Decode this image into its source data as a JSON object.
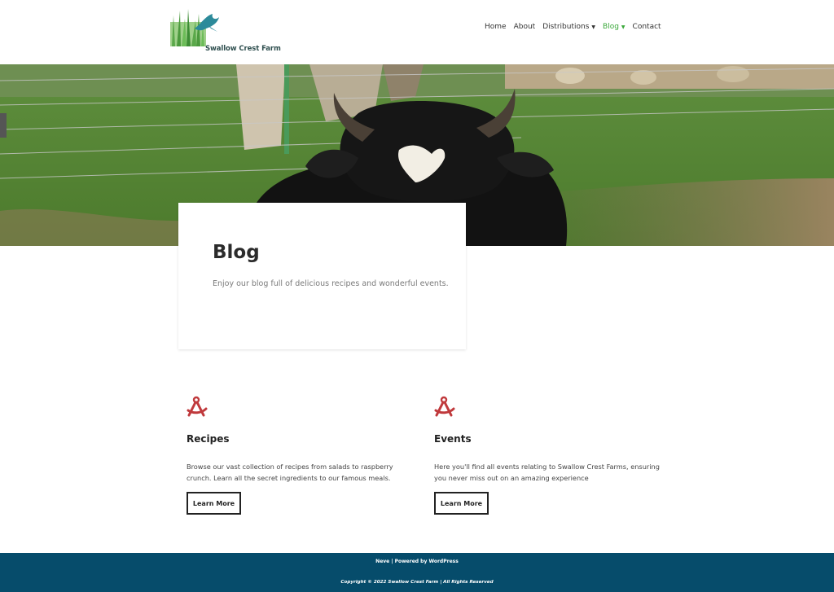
{
  "brand": {
    "name": "Swallow Crest Farm",
    "colors": {
      "accent": "#3aa83a",
      "icon": "#c0393c",
      "footer": "#064c6b"
    }
  },
  "nav": {
    "items": [
      {
        "label": "Home"
      },
      {
        "label": "About"
      },
      {
        "label": "Distributions",
        "dropdown": true
      },
      {
        "label": "Blog",
        "dropdown": true,
        "active": true
      },
      {
        "label": "Contact"
      }
    ]
  },
  "hero_card": {
    "title": "Blog",
    "description": "Enjoy our blog full of delicious recipes and wonderful events."
  },
  "features": [
    {
      "icon": "compass-icon",
      "title": "Recipes",
      "text": "Browse our vast collection of recipes from salads to raspberry crunch. Learn all the secret ingredients to our famous meals.",
      "button": "Learn More"
    },
    {
      "icon": "compass-icon",
      "title": "Events",
      "text": "Here you'll find all events relating to Swallow Crest Farms, ensuring you never miss out on an amazing experience",
      "button": "Learn More"
    }
  ],
  "footer": {
    "credit": "Neve | Powered by WordPress",
    "copyright": "Copyright © 2022 Swallow Crest Farm | All Rights Reserved"
  }
}
